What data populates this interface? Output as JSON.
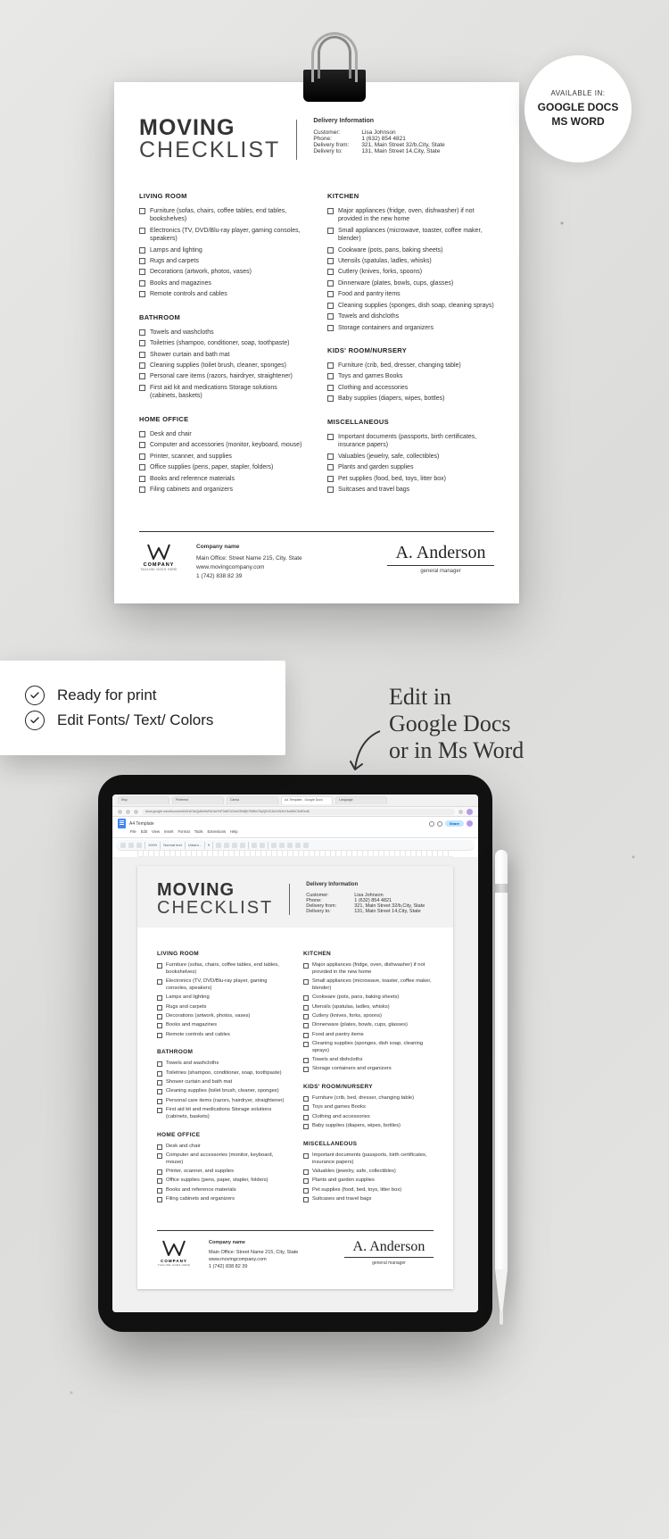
{
  "badge": {
    "available": "AVAILABLE IN:",
    "line1": "GOOGLE DOCS",
    "line2": "MS WORD"
  },
  "doc": {
    "title1": "MOVING",
    "title2": "CHECKLIST",
    "infoTitle": "Delivery Information",
    "info": {
      "customerLbl": "Customer:",
      "customer": "Lisa Johnson",
      "phoneLbl": "Phone:",
      "phone": "1 (632) 854 4821",
      "fromLbl": "Delivery from:",
      "from": "321, Main Street 32/b,City, State",
      "toLbl": "Delivery to:",
      "to": "131, Main Street 14,City, State"
    },
    "sections": {
      "livingRoom": {
        "title": "LIVING ROOM",
        "items": [
          "Furniture (sofas, chairs, coffee tables, end tables, bookshelves)",
          "Electronics (TV, DVD/Blu-ray player, gaming consoles, speakers)",
          "Lamps and lighting",
          "Rugs and carpets",
          "Decorations (artwork, photos, vases)",
          "Books and magazines",
          "Remote controls and cables"
        ]
      },
      "bathroom": {
        "title": "BATHROOM",
        "items": [
          "Towels and washcloths",
          "Toiletries (shampoo, conditioner, soap, toothpaste)",
          "Shower curtain and bath mat",
          "Cleaning supplies (toilet brush, cleaner, sponges)",
          "Personal care items (razors, hairdryer, straightener)",
          "First aid kit and medications Storage solutions (cabinets, baskets)"
        ]
      },
      "homeOffice": {
        "title": "HOME OFFICE",
        "items": [
          "Desk and chair",
          "Computer and accessories (monitor, keyboard, mouse)",
          "Printer, scanner, and supplies",
          "Office supplies (pens, paper, stapler, folders)",
          "Books and reference materials",
          "Filing cabinets and organizers"
        ]
      },
      "kitchen": {
        "title": "KITCHEN",
        "items": [
          "Major appliances (fridge, oven, dishwasher) if not provided in the new home",
          "Small appliances (microwave, toaster, coffee maker, blender)",
          "Cookware (pots, pans, baking sheets)",
          "Utensils (spatulas, ladles, whisks)",
          "Cutlery (knives, forks, spoons)",
          "Dinnerware (plates, bowls, cups, glasses)",
          "Food and pantry items",
          "Cleaning supplies (sponges, dish soap, cleaning sprays)",
          "Towels and dishcloths",
          "Storage containers and organizers"
        ]
      },
      "kidsRoom": {
        "title": "KIDS' ROOM/NURSERY",
        "items": [
          "Furniture (crib, bed, dresser, changing table)",
          "Toys and games Books",
          "Clothing and accessories",
          "Baby supplies (diapers, wipes, bottles)"
        ]
      },
      "misc": {
        "title": "MISCELLANEOUS",
        "items": [
          "Important documents (passports, birth certificates, insurance papers)",
          "Valuables (jewelry, safe, collectibles)",
          "Plants and garden supplies",
          "Pet supplies (food, bed, toys, litter box)",
          "Suitcases and travel bags"
        ]
      }
    },
    "footer": {
      "logoCompany": "COMPANY",
      "logoTag": "TAGLINE GOES HERE",
      "companyName": "Company name",
      "address": "Main Office: Street Name 215, City, State",
      "website": "www.movingcompany.com",
      "phone": "1 (742) 838 82 39",
      "signature": "A. Anderson",
      "signTitle": "general manager"
    }
  },
  "features": {
    "f1": "Ready for print",
    "f2": "Edit Fonts/ Text/ Colors"
  },
  "annotation": {
    "l1": "Edit in",
    "l2": "Google Docs",
    "l3": "or in Ms Word"
  },
  "tablet": {
    "docName": "A4 Template",
    "url": "docs.google.com/document/d/1xK9zQp8mNvRtL3wYhF2aB7cD4eG5hI6jK7lM8nO9pQ0rS1tU2vW3xY4zA5bC6dE/edit",
    "share": "Share",
    "menus": [
      "File",
      "Edit",
      "View",
      "Insert",
      "Format",
      "Tools",
      "Extensions",
      "Help"
    ],
    "toolbar": {
      "zoom": "100%",
      "style": "Normal text",
      "font": "Urbani...",
      "size": "9"
    }
  }
}
